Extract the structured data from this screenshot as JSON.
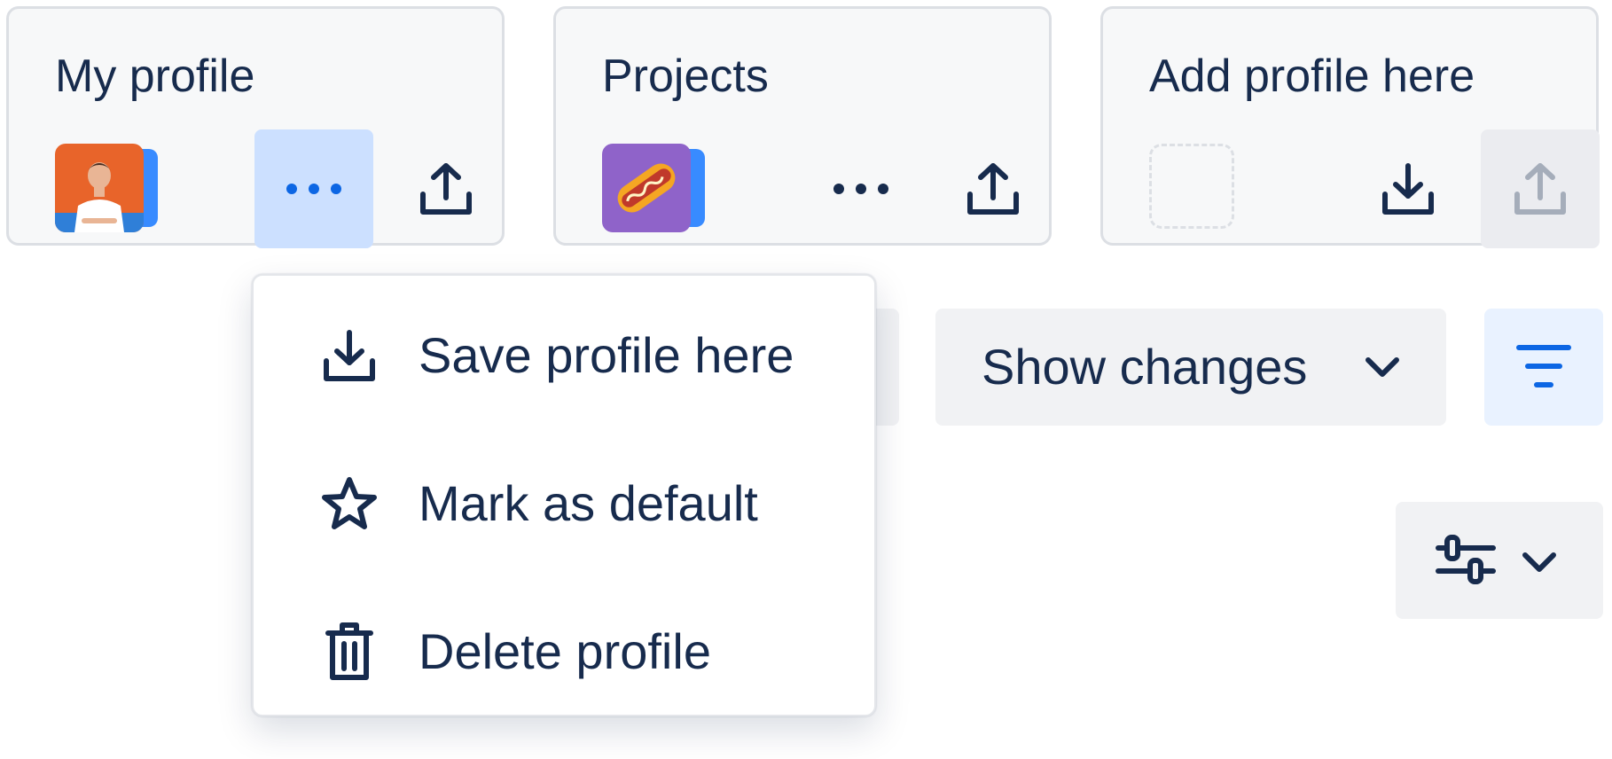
{
  "profiles": [
    {
      "title": "My profile",
      "avatar": "person-photo",
      "more_icon": "more-horizontal-icon",
      "action_icon": "upload-icon"
    },
    {
      "title": "Projects",
      "avatar": "hotdog-illustration",
      "more_icon": "more-horizontal-icon",
      "action_icon": "upload-icon"
    },
    {
      "title": "Add profile here",
      "avatar": "empty-placeholder",
      "action_icon": "download-icon",
      "disabled_icon": "upload-icon"
    }
  ],
  "menu": {
    "items": [
      {
        "label": "Save profile here",
        "icon": "download-icon"
      },
      {
        "label": "Mark as default",
        "icon": "star-icon"
      },
      {
        "label": "Delete profile",
        "icon": "trash-icon"
      }
    ]
  },
  "toolbar": {
    "show_changes_label": "Show changes",
    "show_changes_icon": "chevron-down-icon",
    "filter_icon": "filter-icon",
    "settings_icon": "sliders-icon"
  },
  "colors": {
    "text": "#172b4d",
    "accent": "#0c66e4",
    "accent_bg": "#e9f2ff",
    "active_bg": "#cce0ff",
    "card_bg": "#f7f8f9",
    "card_border": "#dcdfe4",
    "button_bg": "#f1f2f4",
    "avatar_stack": "#388bff",
    "photo_bg": "#e8642a",
    "hotdog_bg": "#8f63c9",
    "disabled_icon": "#a5adba"
  }
}
